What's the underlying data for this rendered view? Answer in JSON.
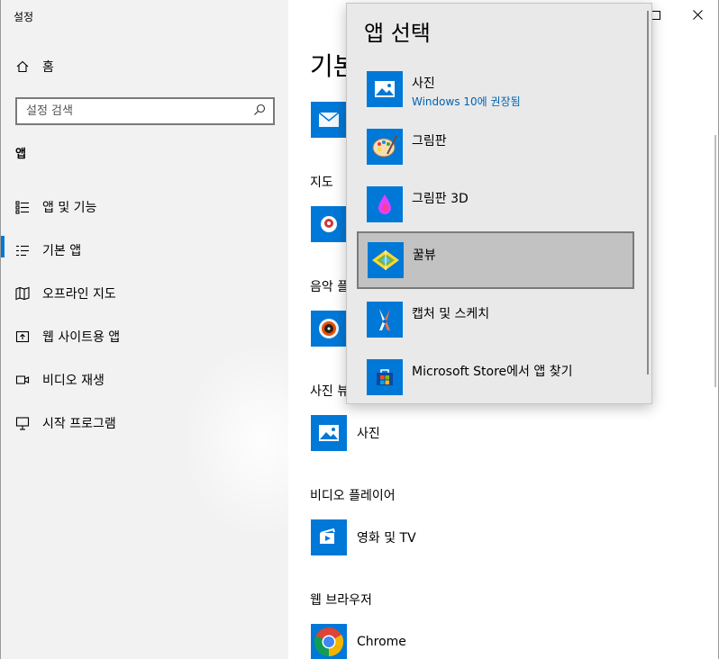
{
  "window": {
    "title": "설정",
    "minimize_icon": "minimize-icon",
    "maximize_icon": "maximize-icon",
    "close_icon": "close-icon"
  },
  "sidebar": {
    "home_label": "홈",
    "search_placeholder": "설정 검색",
    "section_label": "앱",
    "items": [
      {
        "label": "앱 및 기능",
        "icon": "apps-features-icon"
      },
      {
        "label": "기본 앱",
        "icon": "default-apps-icon",
        "active": true
      },
      {
        "label": "오프라인 지도",
        "icon": "offline-maps-icon"
      },
      {
        "label": "웹 사이트용 앱",
        "icon": "apps-for-websites-icon"
      },
      {
        "label": "비디오 재생",
        "icon": "video-playback-icon"
      },
      {
        "label": "시작 프로그램",
        "icon": "startup-icon"
      }
    ]
  },
  "main": {
    "title": "기본",
    "groups": [
      {
        "label": "지도"
      },
      {
        "label": "음악 플"
      },
      {
        "label": "사진 뷰"
      },
      {
        "label": "비디오 플레이어",
        "app": "영화 및 TV"
      },
      {
        "label": "웹 브라우저",
        "app": "Chrome"
      }
    ],
    "photo_app": "사진"
  },
  "flyout": {
    "title": "앱 선택",
    "items": [
      {
        "name": "사진",
        "sub": "Windows 10에 권장됨",
        "icon": "photos-app-icon"
      },
      {
        "name": "그림판",
        "icon": "paint-app-icon"
      },
      {
        "name": "그림판 3D",
        "icon": "paint3d-app-icon"
      },
      {
        "name": "꿀뷰",
        "icon": "honeyview-app-icon",
        "selected": true
      },
      {
        "name": "캡처 및 스케치",
        "icon": "snip-sketch-app-icon"
      },
      {
        "name": "Microsoft Store에서 앱 찾기",
        "icon": "store-app-icon"
      }
    ]
  },
  "colors": {
    "accent": "#0078d7",
    "link": "#0063b1",
    "sidebar_bg": "#f2f2f2",
    "flyout_bg": "#e9e9e9",
    "selected_bg": "#c2c2c2"
  }
}
